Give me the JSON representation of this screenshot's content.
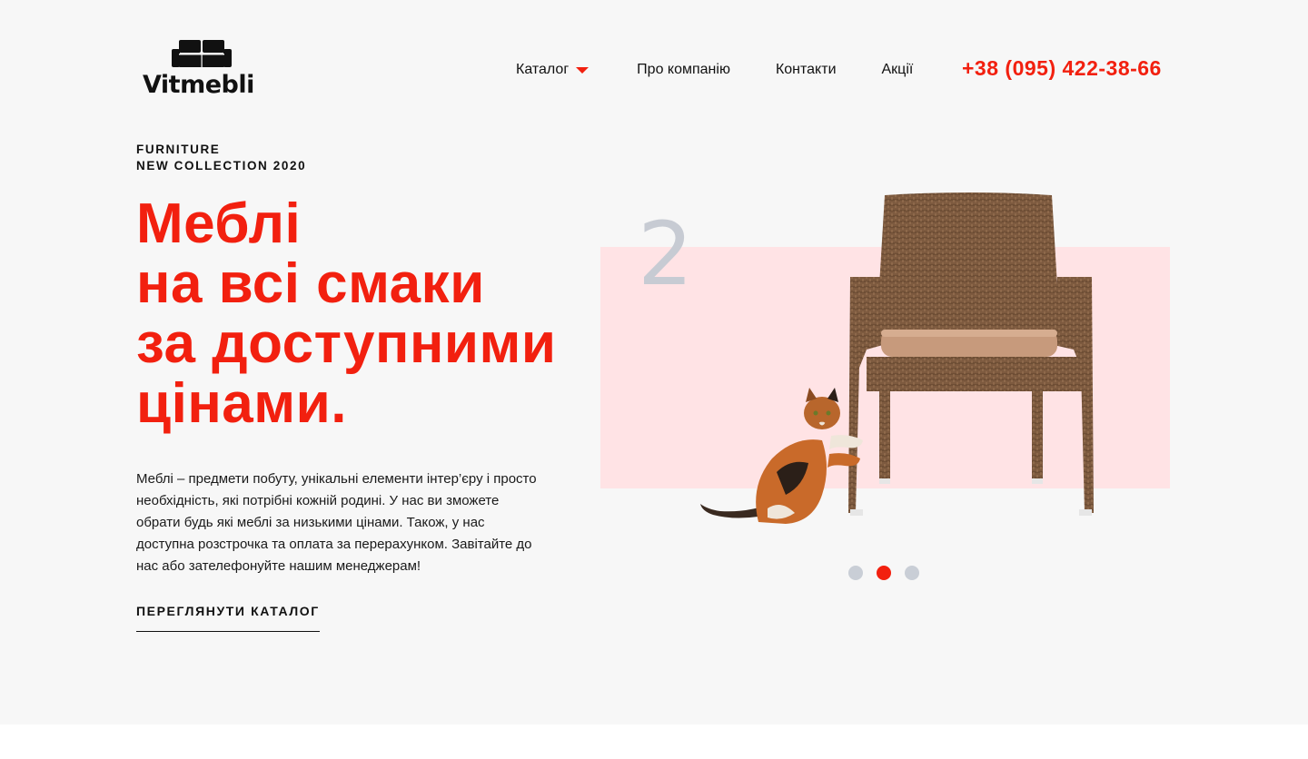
{
  "header": {
    "logo_text": "Vitmebli",
    "logo_icon": "sofa-icon",
    "nav": {
      "catalog": "Каталог",
      "about": "Про компанію",
      "contacts": "Контакти",
      "sales": "Акції"
    },
    "phone": "+38 (095) 422-38-66"
  },
  "hero": {
    "kicker_line1": "FURNITURE",
    "kicker_line2": "NEW COLLECTION 2020",
    "headline": [
      "Меблі",
      "на всі смаки",
      "за доступними",
      "цінами."
    ],
    "description": "Меблі – предмети побуту, унікальні елементи інтер’єру і просто необхідність, які потрібні кожній родині. У нас ви зможете обрати будь які меблі за низькими цінами. Також, у нас доступна розстрочка та оплата за перерахунком. Завітайте до нас або зателефонуйте нашим менеджерам!",
    "cta": "ПЕРЕГЛЯНУТИ КАТАЛОГ"
  },
  "slider": {
    "current_number": "2",
    "total_slides": 3,
    "active_index": 1,
    "image": "wicker-chair-with-cat"
  },
  "colors": {
    "accent": "#f2200f",
    "background": "#f7f7f7",
    "slide_bg": "#ffe3e5",
    "dot_inactive": "#c9ced6"
  }
}
